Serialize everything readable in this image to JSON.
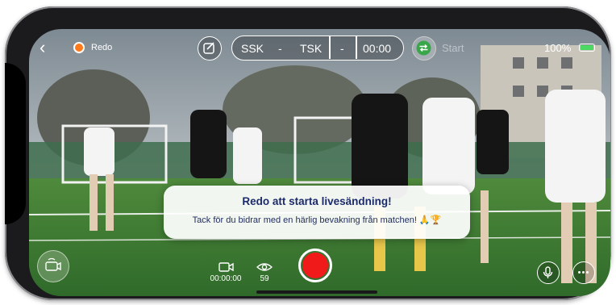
{
  "topbar": {
    "back_icon": "chevron-left-icon",
    "status_label": "Redo",
    "status_color": "#ff7a1a",
    "home_team": "SSK",
    "home_score": "-",
    "away_team": "TSK",
    "period": "-",
    "timer": "00:00",
    "start_label": "Start",
    "battery_percent": "100%",
    "battery_level": 1.0,
    "battery_color": "#4cd964"
  },
  "toast": {
    "title": "Redo att starta livesändning!",
    "message": "Tack för du bidrar med en härlig bevakning från matchen! 🙏🏆"
  },
  "bottombar": {
    "duration": "00:00:00",
    "viewers": "59",
    "record_color": "#f01a1a"
  }
}
